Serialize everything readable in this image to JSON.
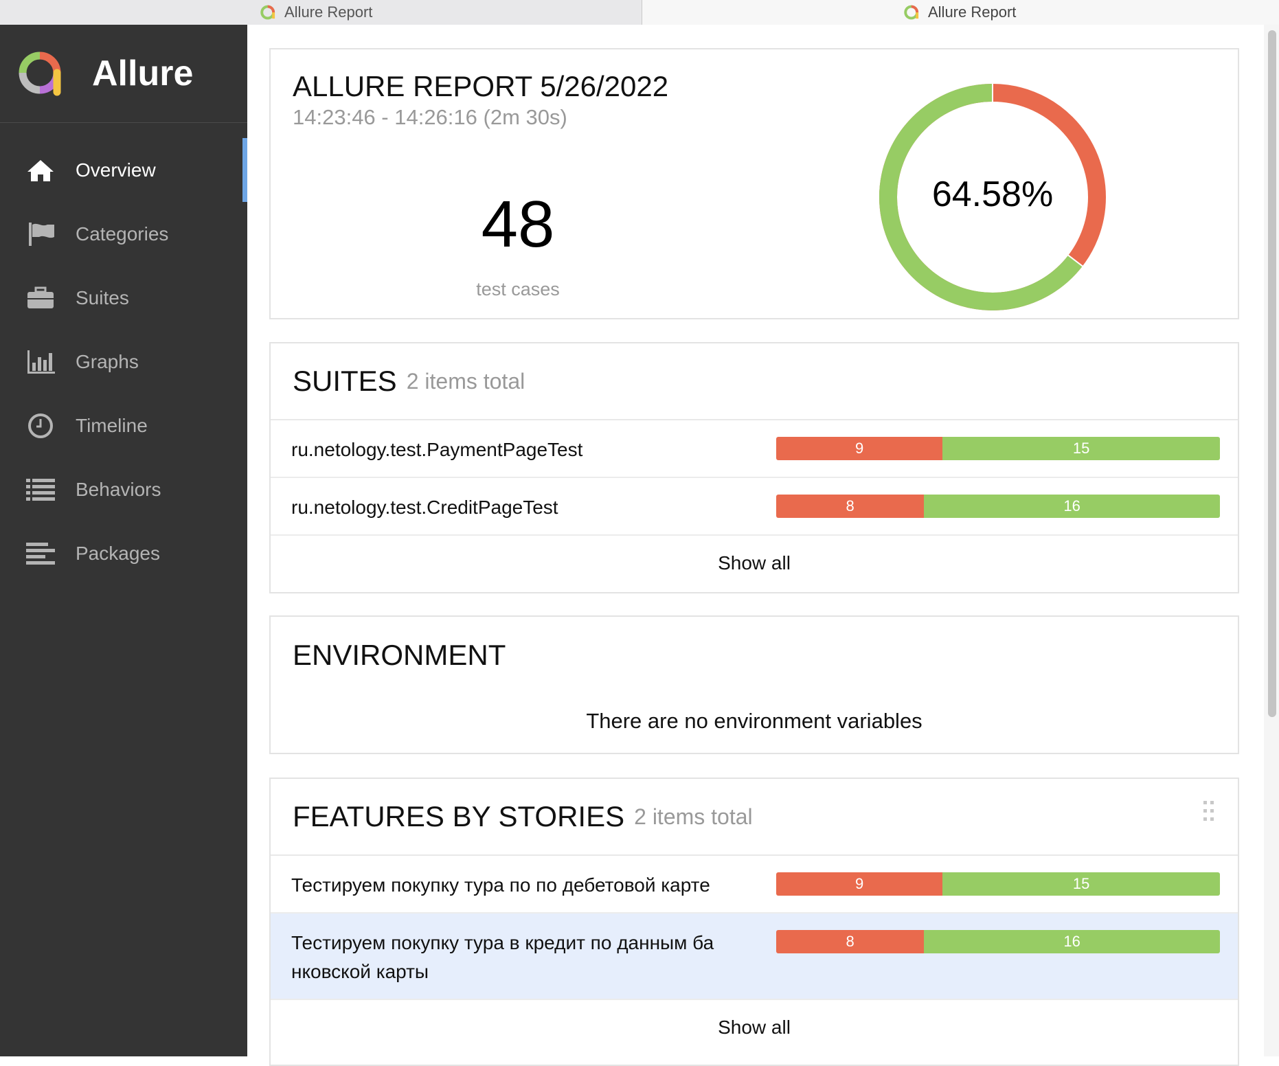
{
  "tabs": [
    {
      "title": "Allure Report"
    },
    {
      "title": "Allure Report"
    }
  ],
  "sidebar": {
    "brand": "Allure",
    "items": [
      {
        "label": "Overview",
        "icon": "home-icon",
        "active": true
      },
      {
        "label": "Categories",
        "icon": "flag-icon",
        "active": false
      },
      {
        "label": "Suites",
        "icon": "briefcase-icon",
        "active": false
      },
      {
        "label": "Graphs",
        "icon": "bar-chart-icon",
        "active": false
      },
      {
        "label": "Timeline",
        "icon": "clock-icon",
        "active": false
      },
      {
        "label": "Behaviors",
        "icon": "list-icon",
        "active": false
      },
      {
        "label": "Packages",
        "icon": "align-left-icon",
        "active": false
      }
    ]
  },
  "summary": {
    "title": "ALLURE REPORT 5/26/2022",
    "time": "14:23:46 - 14:26:16 (2m 30s)",
    "test_count": "48",
    "test_count_label": "test cases",
    "pass_rate": "64.58%",
    "pass_fraction": 0.6458
  },
  "suites": {
    "title": "SUITES",
    "subtitle": "2 items total",
    "rows": [
      {
        "name": "ru.netology.test.PaymentPageTest",
        "failed": "9",
        "passed": "15"
      },
      {
        "name": "ru.netology.test.CreditPageTest",
        "failed": "8",
        "passed": "16"
      }
    ],
    "show_all": "Show all"
  },
  "environment": {
    "title": "ENVIRONMENT",
    "message": "There are no environment variables"
  },
  "features": {
    "title": "FEATURES BY STORIES",
    "subtitle": "2 items total",
    "rows": [
      {
        "name": "Тестируем покупку тура по по дебетовой карте",
        "failed": "9",
        "passed": "15"
      },
      {
        "name": "Тестируем покупку тура в кредит по данным ба нковской карты",
        "failed": "8",
        "passed": "16"
      }
    ],
    "show_all": "Show all"
  },
  "colors": {
    "failed": "#e96a4d",
    "passed": "#97cc64",
    "sidebar_bg": "#343434",
    "active_indicator": "#6ea6e6"
  }
}
